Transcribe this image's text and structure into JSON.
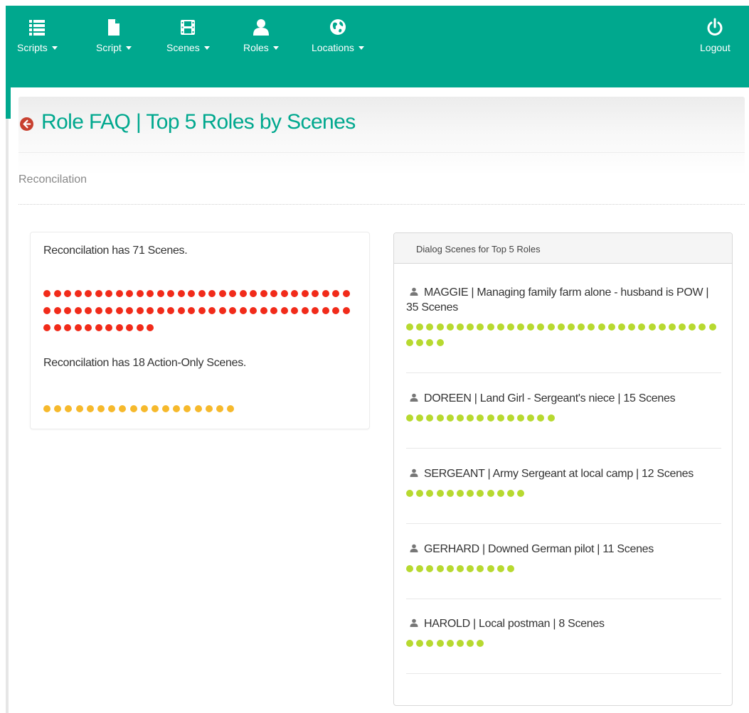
{
  "nav": {
    "items": [
      {
        "label": "Scripts",
        "icon": "list-icon"
      },
      {
        "label": "Script",
        "icon": "document-icon"
      },
      {
        "label": "Scenes",
        "icon": "film-icon"
      },
      {
        "label": "Roles",
        "icon": "user-icon"
      },
      {
        "label": "Locations",
        "icon": "globe-icon"
      }
    ],
    "logout_label": "Logout"
  },
  "page": {
    "title": "Role FAQ | Top 5 Roles by Scenes",
    "subtitle": "Reconcilation"
  },
  "summary": {
    "scenes_text": "Reconcilation has 71 Scenes.",
    "scene_count": 71,
    "action_text": "Reconcilation has 18 Action-Only Scenes.",
    "action_count": 18
  },
  "panel": {
    "heading": "Dialog Scenes for Top 5 Roles",
    "roles": [
      {
        "title": "MAGGIE | Managing family farm alone - husband is POW | 35 Scenes",
        "scenes": 35
      },
      {
        "title": "DOREEN | Land Girl - Sergeant's niece | 15 Scenes",
        "scenes": 15
      },
      {
        "title": "SERGEANT | Army Sergeant at local camp | 12 Scenes",
        "scenes": 12
      },
      {
        "title": "GERHARD | Downed German pilot | 11 Scenes",
        "scenes": 11
      },
      {
        "title": "HAROLD | Local postman | 8 Scenes",
        "scenes": 8
      }
    ]
  },
  "colors": {
    "brand": "#00a88e",
    "scene_dot": "#f12b1a",
    "action_dot": "#f6b92c",
    "role_dot": "#b7d930",
    "back_icon": "#c8402f"
  }
}
